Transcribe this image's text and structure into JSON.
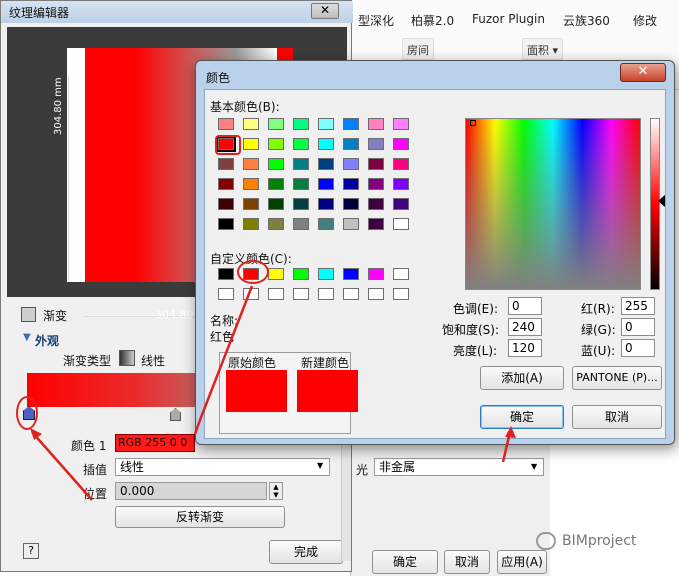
{
  "background": {
    "ribbon_tabs": [
      "型深化",
      "柏慕2.0",
      "Fuzor Plugin",
      "云族360",
      "修改"
    ],
    "ribbon_buttons": [
      "房间",
      "面积 ▾"
    ],
    "light_label": "光",
    "light_value": "非金属",
    "ok_label": "确定",
    "cancel_label": "取消",
    "apply_label": "应用(A)"
  },
  "watermark": "BIMproject",
  "texture_editor": {
    "title": "纹理编辑器",
    "close_glyph": "✕",
    "dim_vertical": "304.80 mm",
    "dim_horizontal": "304.80",
    "gradient_checkbox_label": "渐变",
    "appearance_heading": "外观",
    "gradient_type_label": "渐变类型",
    "gradient_type_value": "线性",
    "color1_label": "颜色 1",
    "color1_value": "RGB 255 0 0",
    "interp_label": "插值",
    "interp_value": "线性",
    "position_label": "位置",
    "position_value": "0.000",
    "reverse_button": "反转渐变",
    "help_button": "?",
    "done_button": "完成"
  },
  "color_dialog": {
    "title": "颜色",
    "close_glyph": "✕",
    "basic_colors_label": "基本颜色(B):",
    "custom_colors_label": "自定义颜色(C):",
    "name_label": "名称:",
    "name_value": "红色",
    "original_label": "原始颜色",
    "new_label": "新建颜色",
    "hue_label": "色调(E):",
    "hue_value": "0",
    "sat_label": "饱和度(S):",
    "sat_value": "240",
    "lum_label": "亮度(L):",
    "lum_value": "120",
    "red_label": "红(R):",
    "red_value": "255",
    "green_label": "绿(G):",
    "green_value": "0",
    "blue_label": "蓝(U):",
    "blue_value": "0",
    "add_button": "添加(A)",
    "pantone_button": "PANTONE (P)...",
    "ok_button": "确定",
    "cancel_button": "取消",
    "basic_colors": [
      [
        "#ff8080",
        "#ffff80",
        "#80ff80",
        "#00ff80",
        "#80ffff",
        "#0080ff",
        "#ff80c0",
        "#ff80ff"
      ],
      [
        "#ff0000",
        "#ffff00",
        "#80ff00",
        "#00ff40",
        "#00ffff",
        "#0080c0",
        "#8080c0",
        "#ff00ff"
      ],
      [
        "#804040",
        "#ff8040",
        "#00ff00",
        "#008080",
        "#004080",
        "#8080ff",
        "#800040",
        "#ff0080"
      ],
      [
        "#800000",
        "#ff8000",
        "#008000",
        "#008040",
        "#0000ff",
        "#0000a0",
        "#800080",
        "#8000ff"
      ],
      [
        "#400000",
        "#804000",
        "#004000",
        "#004040",
        "#000080",
        "#000040",
        "#400040",
        "#400080"
      ],
      [
        "#000000",
        "#808000",
        "#808040",
        "#808080",
        "#408080",
        "#c0c0c0",
        "#400040",
        "#ffffff"
      ]
    ],
    "custom_colors": [
      [
        "#000000",
        "#ff0000",
        "#ffff00",
        "#00ff00",
        "#00ffff",
        "#0000ff",
        "#ff00ff",
        "#ffffff"
      ],
      [
        "#ffffff",
        "#ffffff",
        "#ffffff",
        "#ffffff",
        "#ffffff",
        "#ffffff",
        "#ffffff",
        "#ffffff"
      ]
    ]
  }
}
